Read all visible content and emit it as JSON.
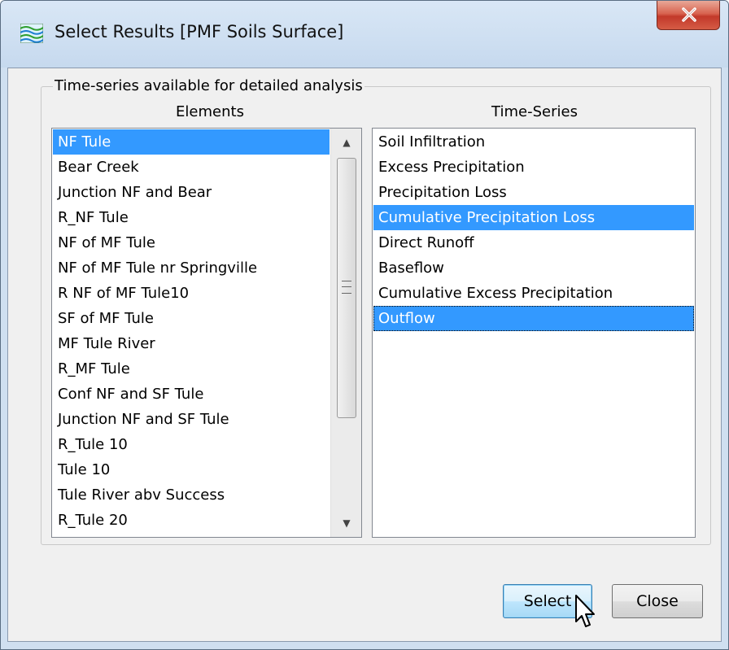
{
  "window": {
    "title": "Select Results [PMF Soils Surface]"
  },
  "group": {
    "legend": "Time-series available for detailed analysis"
  },
  "elements": {
    "header": "Elements",
    "items": [
      {
        "label": "NF Tule",
        "selected": true
      },
      {
        "label": "Bear Creek"
      },
      {
        "label": "Junction NF and Bear"
      },
      {
        "label": "R_NF Tule"
      },
      {
        "label": "NF of MF Tule"
      },
      {
        "label": "NF of MF Tule nr Springville"
      },
      {
        "label": "R NF of MF Tule10"
      },
      {
        "label": "SF of MF Tule"
      },
      {
        "label": "MF Tule River"
      },
      {
        "label": "R_MF Tule"
      },
      {
        "label": "Conf NF and SF Tule"
      },
      {
        "label": "Junction NF and SF Tule"
      },
      {
        "label": "R_Tule 10"
      },
      {
        "label": "Tule 10"
      },
      {
        "label": "Tule River abv Success"
      },
      {
        "label": "R_Tule 20"
      }
    ]
  },
  "timeseries": {
    "header": "Time-Series",
    "items": [
      {
        "label": "Soil Infiltration"
      },
      {
        "label": "Excess Precipitation"
      },
      {
        "label": "Precipitation Loss"
      },
      {
        "label": "Cumulative Precipitation Loss",
        "selected": true
      },
      {
        "label": "Direct Runoff"
      },
      {
        "label": "Baseflow"
      },
      {
        "label": "Cumulative Excess Precipitation"
      },
      {
        "label": "Outflow",
        "selected": true,
        "focused": true
      }
    ]
  },
  "buttons": {
    "select_label": "Select",
    "close_label": "Close"
  },
  "colors": {
    "selection": "#3399ff",
    "close_button": "#c2392a"
  }
}
